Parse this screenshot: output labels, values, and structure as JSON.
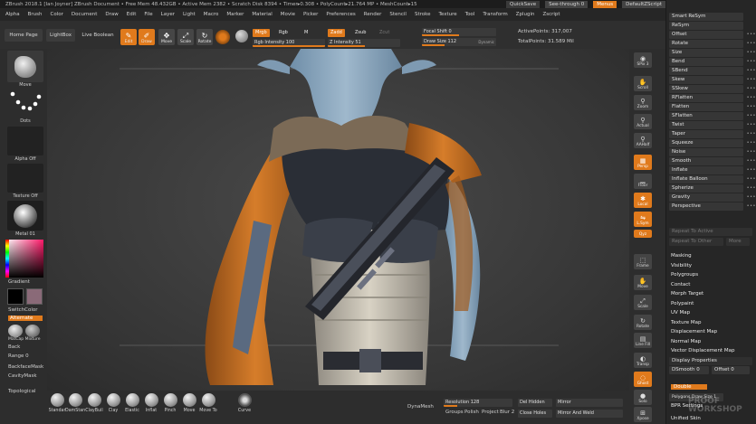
{
  "titlebar": {
    "text": "ZBrush 2018.1 [Ian Joyner]    ZBrush Document    • Free Mem 48.432GB • Active Mem 2382 • Scratch Disk 8394 • Timer▸0.308 • PolyCount▸21.764 MP • MeshCount▸15",
    "quicksave": "QuickSave",
    "seethrough": "See-through  0",
    "menus": "Menus",
    "script": "DefaultZScript"
  },
  "menubar": [
    "Alpha",
    "Brush",
    "Color",
    "Document",
    "Draw",
    "Edit",
    "File",
    "Layer",
    "Light",
    "Macro",
    "Marker",
    "Material",
    "Movie",
    "Picker",
    "Preferences",
    "Render",
    "Stencil",
    "Stroke",
    "Texture",
    "Tool",
    "Transform",
    "Zplugin",
    "Zscript"
  ],
  "topshelf": {
    "home_page": "Home Page",
    "lightbox": "LightBox",
    "live_boolean": "Live Boolean",
    "tools": [
      {
        "label": "Edit",
        "icon": "edit-icon"
      },
      {
        "label": "Draw",
        "icon": "draw-icon"
      },
      {
        "label": "Move",
        "icon": "move-icon"
      },
      {
        "label": "Scale",
        "icon": "scale-icon"
      },
      {
        "label": "Rotate",
        "icon": "rotate-icon"
      }
    ],
    "mrgb": "Mrgb",
    "rgb": "Rgb",
    "m": "M",
    "zadd": "Zadd",
    "zsub": "Zsub",
    "zcut": "Zcut",
    "rgb_intensity": "Rgb Intensity 100",
    "z_intensity": "Z Intensity 51",
    "focal_shift": "Focal Shift 0",
    "draw_size": "Draw Size 112",
    "dynamic": "Dynamic",
    "active_points": "ActivePoints: 317,007",
    "total_points": "TotalPoints: 31.589 Mil"
  },
  "leftshelf": {
    "move": "Move",
    "dots": "Dots",
    "alpha_off": "Alpha Off",
    "texture_off": "Texture Off",
    "material": "Metal 01",
    "gradient": "Gradient",
    "switchcolor": "SwitchColor",
    "alternate": "Alternate",
    "matcap": "MatCap Mixture",
    "back": "Back",
    "range": "Range 0",
    "backface": "BackfaceMask",
    "cavity": "CavityMask",
    "topological": "Topological"
  },
  "brushes": [
    "Standar",
    "DamStan",
    "ClayBuil",
    "Clay",
    "Elastic",
    "Inflat",
    "Pinch",
    "Move",
    "Move To"
  ],
  "bottomshelf": {
    "curve": "Curve",
    "dynamesh": "DynaMesh",
    "resolution": "Resolution 128",
    "groups": "Groups",
    "polish": "Polish",
    "project": "Project",
    "blur": "Blur 2",
    "del_hidden": "Del Hidden",
    "close_holes": "Close Holes",
    "mirror": "Mirror",
    "mirror_weld": "Mirror And Weld"
  },
  "rightshelf": [
    {
      "label": "SPix 3",
      "icon": "bpr-icon"
    },
    {
      "label": "Scroll",
      "icon": "scroll-icon"
    },
    {
      "label": "Zoom",
      "icon": "zoom-icon"
    },
    {
      "label": "Actual",
      "icon": "actual-icon"
    },
    {
      "label": "AAHalf",
      "icon": "aahalf-icon"
    },
    {
      "label": "Persp",
      "icon": "persp-icon"
    },
    {
      "label": "Floor",
      "icon": "floor-icon"
    },
    {
      "label": "Local",
      "icon": "local-icon"
    },
    {
      "label": "L.Sym",
      "icon": "lsym-icon"
    },
    {
      "label": "Qyz",
      "icon": "axis-icon"
    },
    {
      "label": "Frame",
      "icon": "frame-icon"
    },
    {
      "label": "Move",
      "icon": "move-icon"
    },
    {
      "label": "Scale",
      "icon": "scale-icon"
    },
    {
      "label": "Rotate",
      "icon": "rotate-icon"
    },
    {
      "label": "Line Fill",
      "icon": "linefill-icon"
    },
    {
      "label": "Transp",
      "icon": "transp-icon"
    },
    {
      "label": "Ghost",
      "icon": "ghost-icon"
    },
    {
      "label": "Solo",
      "icon": "solo-icon"
    },
    {
      "label": "Xpose",
      "icon": "xpose-icon"
    }
  ],
  "tray": {
    "deformation_items": [
      "Smart ReSym",
      "ReSym",
      "Offset",
      "Rotate",
      "Size",
      "Bend",
      "SBend",
      "Skew",
      "SSkew",
      "RFlatten",
      "Flatten",
      "SFlatten",
      "Twist",
      "Taper",
      "Squeeze",
      "Noise",
      "Smooth",
      "Inflate",
      "Inflate Balloon",
      "Spherize",
      "Gravity",
      "Perspective"
    ],
    "repeat_active": "Repeat To Active",
    "repeat_other": "Repeat To Other",
    "more": "More",
    "sections": [
      "Masking",
      "Visibility",
      "Polygroups",
      "Contact",
      "Morph Target",
      "Polypaint",
      "UV Map",
      "Texture Map",
      "Displacement Map",
      "Normal Map",
      "Vector Displacement Map"
    ],
    "display_properties": "Display Properties",
    "dsmooth": "DSmooth 0",
    "offset": "Offset 0",
    "double": "Double",
    "polygons_draw": "Polygons Draw Size 1",
    "bpr_settings": "BPR Settings",
    "unified_skin": "Unified Skin"
  },
  "watermark": "PROOF WORKSHOP",
  "colors": {
    "accent": "#e07a1c",
    "background": "#2a2a2a",
    "viewport": "#3c3c3c"
  }
}
